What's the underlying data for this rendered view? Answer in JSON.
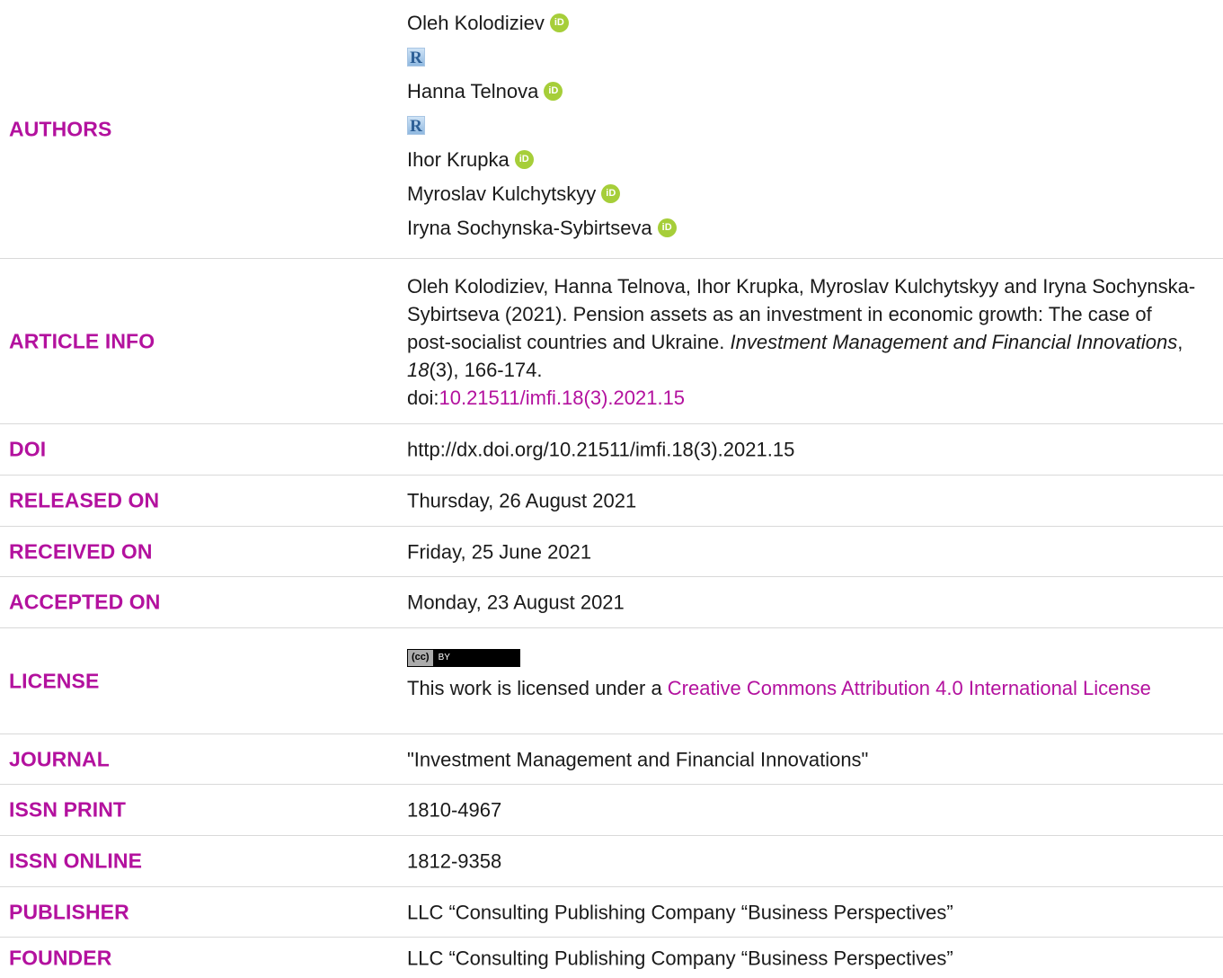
{
  "authors": {
    "label": "AUTHORS",
    "list": [
      {
        "name": "Oleh Kolodiziev",
        "orcid": "iD",
        "researcher_id": "R"
      },
      {
        "name": "Hanna Telnova",
        "orcid": "iD",
        "researcher_id": "R"
      },
      {
        "name": "Ihor Krupka",
        "orcid": "iD"
      },
      {
        "name": "Myroslav Kulchytskyy",
        "orcid": "iD"
      },
      {
        "name": "Iryna Sochynska-Sybirtseva",
        "orcid": "iD"
      }
    ]
  },
  "article_info": {
    "label": "ARTICLE INFO",
    "citation_start": "Oleh Kolodiziev, Hanna Telnova, Ihor Krupka, Myroslav Kulchytskyy and Iryna Sochynska-Sybirtseva (2021). Pension assets as an investment in economic growth: The case of post-socialist countries and Ukraine. ",
    "journal_italic": "Investment Management and Financial Innovations",
    "sep1": ", ",
    "volume_italic": "18",
    "issue_pages": "(3), 166-174.",
    "doi_prefix": "doi:",
    "doi_link": "10.21511/imfi.18(3).2021.15"
  },
  "doi": {
    "label": "DOI",
    "value": "http://dx.doi.org/10.21511/imfi.18(3).2021.15"
  },
  "released": {
    "label": "RELEASED ON",
    "value": "Thursday, 26 August 2021"
  },
  "received": {
    "label": "RECEIVED ON",
    "value": "Friday, 25 June 2021"
  },
  "accepted": {
    "label": "ACCEPTED ON",
    "value": "Monday, 23 August 2021"
  },
  "license": {
    "label": "LICENSE",
    "badge_left": "(cc)",
    "badge_right": "BY",
    "text_prefix": "This work is licensed under a ",
    "link_text": "Creative Commons Attribution 4.0 International License"
  },
  "journal": {
    "label": "JOURNAL",
    "value": "\"Investment Management and Financial Innovations\""
  },
  "issn_print": {
    "label": "ISSN PRINT",
    "value": "1810-4967"
  },
  "issn_online": {
    "label": "ISSN ONLINE",
    "value": "1812-9358"
  },
  "publisher": {
    "label": "PUBLISHER",
    "value": "LLC “Consulting Publishing Company “Business Perspectives”"
  },
  "founder": {
    "label": "FOUNDER",
    "value": "LLC “Consulting Publishing Company “Business Perspectives”"
  },
  "colors": {
    "label": "#b3119e",
    "link": "#b3119e",
    "orcid": "#a6ce39",
    "divider": "#d9d9d9"
  }
}
